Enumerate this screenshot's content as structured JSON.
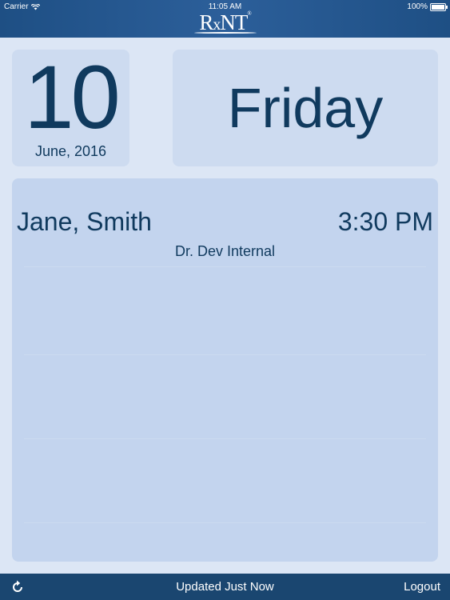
{
  "status_bar": {
    "carrier": "Carrier",
    "time": "11:05 AM",
    "battery": "100%",
    "battery_level": 1.0
  },
  "header": {
    "logo_main": "R",
    "logo_sub": "x",
    "logo_rest": "NT",
    "logo_tm": "®"
  },
  "date_card": {
    "day_number": "10",
    "month_year": "June, 2016"
  },
  "weekday_card": {
    "weekday": "Friday"
  },
  "appointments": [
    {
      "patient": "Jane, Smith",
      "time": "3:30 PM",
      "provider": "Dr. Dev Internal"
    }
  ],
  "footer": {
    "updated_text": "Updated Just Now",
    "logout_label": "Logout"
  },
  "icons": {
    "wifi": "wifi-icon",
    "battery": "battery-icon",
    "refresh": "refresh-icon"
  },
  "colors": {
    "header": "#2c5f9a",
    "footer": "#1a4670",
    "background": "#dce6f5",
    "panel": "#cddbf0",
    "text": "#103a5e"
  }
}
